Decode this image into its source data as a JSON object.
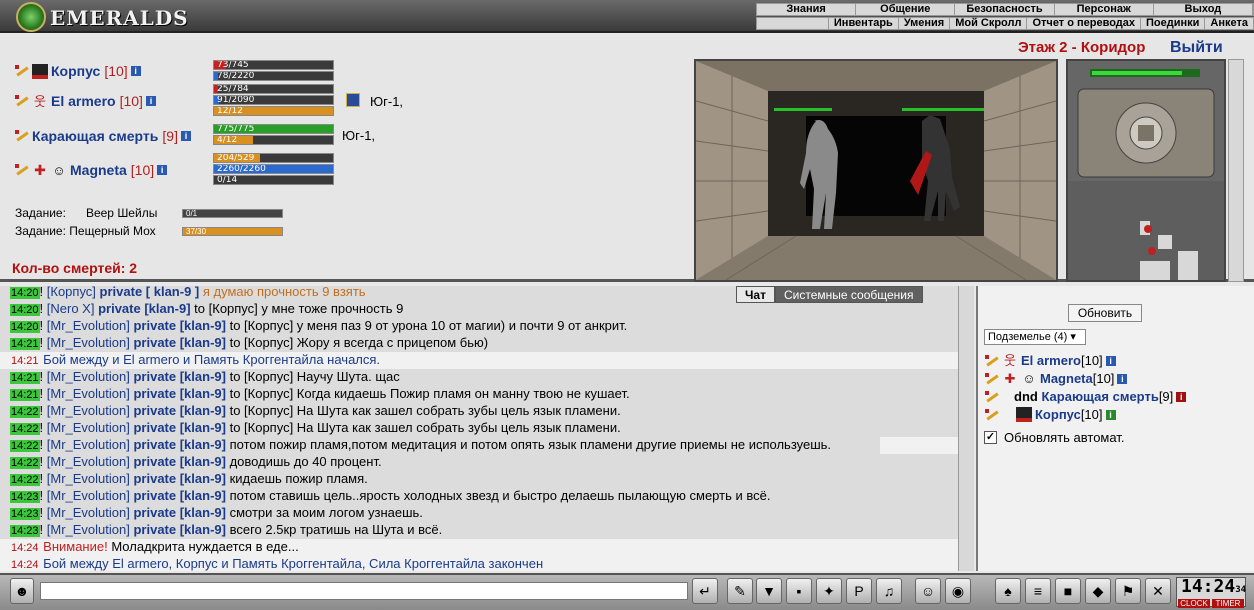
{
  "logo_text": "EMERALDS",
  "menu_main": [
    "Знания",
    "Общение",
    "Безопасность",
    "Персонаж",
    "Выход"
  ],
  "menu_sub": [
    "Инвентарь",
    "Умения",
    "Мой Скролл",
    "Отчет о переводах",
    "Поединки",
    "Анкета"
  ],
  "location": "Этаж 2 - Коридор",
  "exit_label": "Выйти",
  "party": [
    {
      "name": "Корпус",
      "level": "[10]",
      "bars": [
        {
          "text": "73/745",
          "kind": "red",
          "fill": 0.098
        },
        {
          "text": "78/2220",
          "kind": "blue",
          "fill": 0.035
        }
      ]
    },
    {
      "name": "El armero",
      "level": "[10]",
      "bars": [
        {
          "text": "25/784",
          "kind": "red",
          "fill": 0.032
        },
        {
          "text": "91/2090",
          "kind": "blue",
          "fill": 0.044
        },
        {
          "text": "12/12",
          "kind": "orange",
          "fill": 1.0
        }
      ],
      "direction": "Юг-1,"
    },
    {
      "name": "Карающая смерть",
      "level": "[9]",
      "bars": [
        {
          "text": "775/775",
          "kind": "green",
          "fill": 1.0
        },
        {
          "text": "4/12",
          "kind": "orange",
          "fill": 0.33
        }
      ],
      "direction": "Юг-1,"
    },
    {
      "name": "Magneta",
      "level": "[10]",
      "bars": [
        {
          "text": "204/529",
          "kind": "orange",
          "fill": 0.386
        },
        {
          "text": "2260/2260",
          "kind": "blue",
          "fill": 1.0
        },
        {
          "text": "0/14",
          "kind": "orange",
          "fill": 0.0
        }
      ]
    }
  ],
  "tasks": [
    {
      "label": "Задание:",
      "name": "Веер Шейлы",
      "progress": "0/1",
      "fill": 0.0
    },
    {
      "label": "Задание:",
      "name": "Пещерный Мох",
      "progress": "37/30",
      "fill": 1.0
    }
  ],
  "deaths": "Кол-во смертей: 2",
  "chat_tabs": {
    "chat": "Чат",
    "system": "Системные сообщения"
  },
  "chat_lines": [
    {
      "ts": "14:20",
      "nick": "[Корпус]",
      "priv": "private [ klan-9 ]",
      "text": " я думаю прочность 9 взять"
    },
    {
      "ts": "14:20",
      "nick": "[Nero X]",
      "priv": "private [klan-9]",
      "text": " to [Корпус] у мне тоже прочность 9"
    },
    {
      "ts": "14:20",
      "nick": "[Mr_Evolution]",
      "priv": "private [klan-9]",
      "text": " to [Корпус] у меня паз 9 от урона 10 от магии) и почти 9 от анкрит."
    },
    {
      "ts": "14:21",
      "nick": "[Mr_Evolution]",
      "priv": "private [klan-9]",
      "text": " to [Корпус] Жору я всегда с прицепом бью)"
    },
    {
      "ts": "14:21",
      "system": "Бой между и El armero и Память Кроггентайла начался."
    },
    {
      "ts": "14:21",
      "nick": "[Mr_Evolution]",
      "priv": "private [klan-9]",
      "text": " to [Корпус] Научу Шута. щас"
    },
    {
      "ts": "14:21",
      "nick": "[Mr_Evolution]",
      "priv": "private [klan-9]",
      "text": " to [Корпус] Когда кидаешь Пожир пламя он манну твою не кушает."
    },
    {
      "ts": "14:22",
      "nick": "[Mr_Evolution]",
      "priv": "private [klan-9]",
      "text": " to [Корпус] На Шута как зашел собрать зубы цель язык пламени."
    },
    {
      "ts": "14:22",
      "nick": "[Mr_Evolution]",
      "priv": "private [klan-9]",
      "text": " to [Корпус] На Шута как зашел собрать зубы цель язык пламени."
    },
    {
      "ts": "14:22",
      "nick": "[Mr_Evolution]",
      "priv": "private [klan-9]",
      "text": " потом пожир пламя,потом медитация и потом опять язык пламени другие приемы не используешь."
    },
    {
      "ts": "14:22",
      "nick": "[Mr_Evolution]",
      "priv": "private [klan-9]",
      "text": " доводишь до 40 процент."
    },
    {
      "ts": "14:22",
      "nick": "[Mr_Evolution]",
      "priv": "private [klan-9]",
      "text": " кидаешь пожир пламя."
    },
    {
      "ts": "14:23",
      "nick": "[Mr_Evolution]",
      "priv": "private [klan-9]",
      "text": " потом ставишь цель..ярость холодных звезд и быстро делаешь пылающую смерть и всё."
    },
    {
      "ts": "14:23",
      "nick": "[Mr_Evolution]",
      "priv": "private [klan-9]",
      "text": " смотри за моим логом узнаешь."
    },
    {
      "ts": "14:23",
      "nick": "[Mr_Evolution]",
      "priv": "private [klan-9]",
      "text": " всего 2.5кр тратишь на Шута и всё."
    },
    {
      "ts": "14:24",
      "warn": "Внимание!",
      "text": " Моладкрита нуждается в еде..."
    },
    {
      "ts": "14:24",
      "system": "Бой между El armero, Корпус и Память Кроггентайла, Сила Кроггентайла закончен"
    }
  ],
  "right_panel": {
    "refresh_label": "Обновить",
    "location_select": "Подземелье (4)",
    "members": [
      {
        "name": "El armero",
        "level": "[10]"
      },
      {
        "name": "Magneta",
        "level": "[10]"
      },
      {
        "prefix": "dnd",
        "name": "Карающая смерть",
        "level": "[9]"
      },
      {
        "name": "Корпус",
        "level": "[10]"
      }
    ],
    "auto_update_label": "Обновлять автомат."
  },
  "clock": {
    "time": "14:24",
    "seconds": "34",
    "clock_label": "CLOCK",
    "timer_label": "TIMER"
  }
}
